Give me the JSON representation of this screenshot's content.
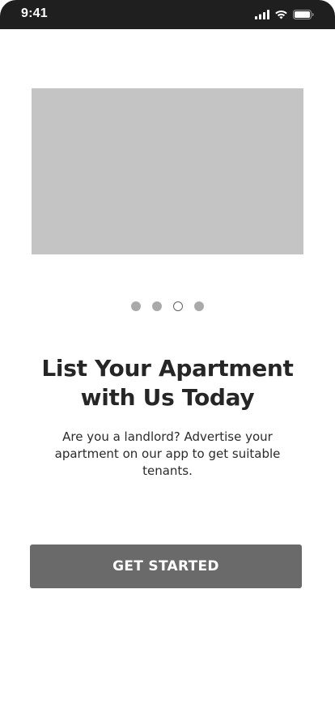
{
  "status_bar": {
    "time": "9:41",
    "icons": [
      "signal-icon",
      "wifi-icon",
      "battery-icon"
    ]
  },
  "carousel": {
    "image_placeholder_color": "#c4c4c4",
    "page_count": 4,
    "active_index": 2
  },
  "onboarding": {
    "headline_line1": "List Your Apartment",
    "headline_line2": "with Us Today",
    "description": "Are you a landlord? Advertise your apartment on our app to get suitable tenants."
  },
  "cta": {
    "label": "GET STARTED",
    "color": "#6a6a6a"
  }
}
